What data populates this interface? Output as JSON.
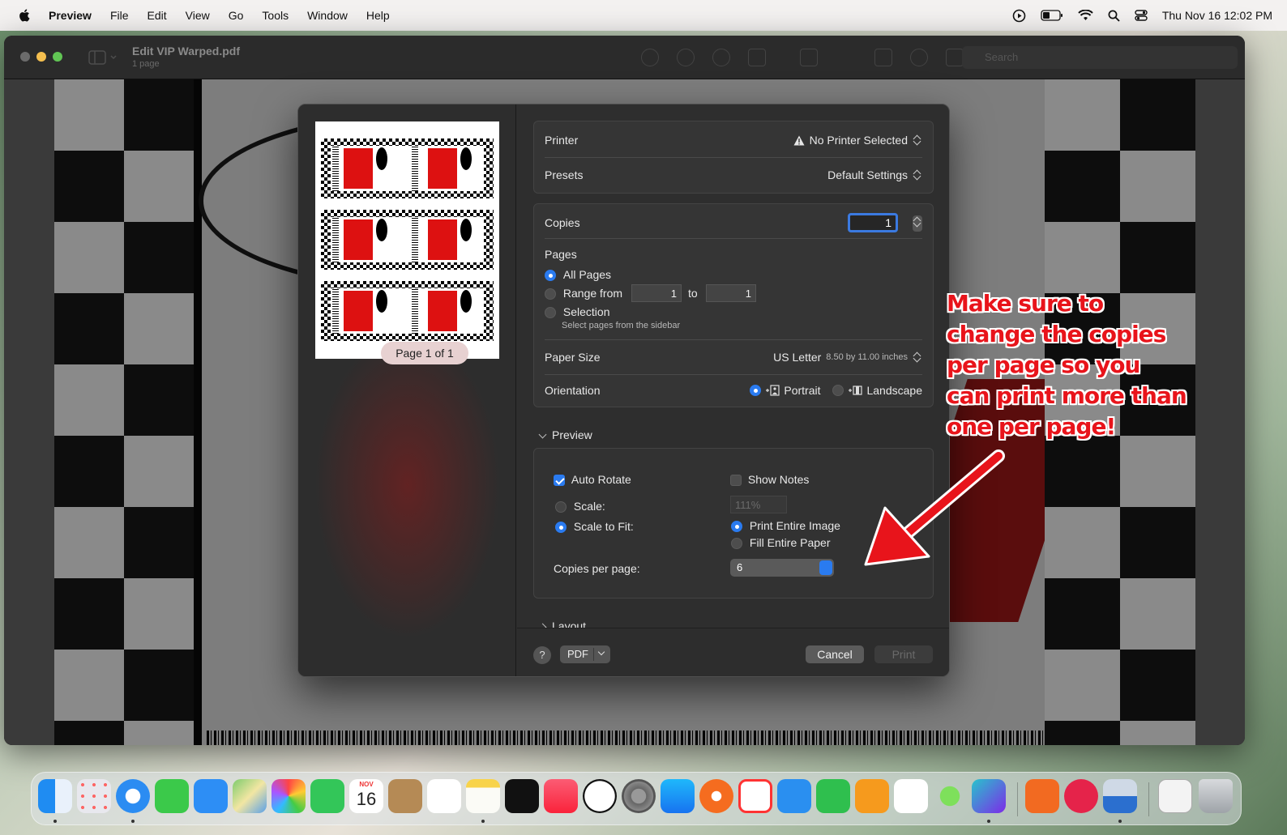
{
  "menubar": {
    "app_name": "Preview",
    "items": [
      "File",
      "Edit",
      "View",
      "Go",
      "Tools",
      "Window",
      "Help"
    ],
    "clock": "Thu Nov 16  12:02 PM"
  },
  "window": {
    "title": "Edit VIP Warped.pdf",
    "subtitle": "1 page",
    "search_placeholder": "Search"
  },
  "dialog": {
    "thumbnail": {
      "page_label": "Page 1 of 1"
    },
    "printer": {
      "label": "Printer",
      "value": "No Printer Selected"
    },
    "presets": {
      "label": "Presets",
      "value": "Default Settings"
    },
    "copies": {
      "label": "Copies",
      "value": "1"
    },
    "pages": {
      "label": "Pages",
      "all_pages": "All Pages",
      "range_from": "Range from",
      "range_start": "1",
      "to": "to",
      "range_end": "1",
      "selection": "Selection",
      "selection_hint": "Select pages from the sidebar",
      "selected": "all_pages"
    },
    "paper_size": {
      "label": "Paper Size",
      "value": "US Letter",
      "detail": "8.50 by 11.00 inches"
    },
    "orientation": {
      "label": "Orientation",
      "portrait": "Portrait",
      "landscape": "Landscape",
      "selected": "portrait"
    },
    "preview_section": {
      "title": "Preview",
      "auto_rotate": "Auto Rotate",
      "auto_rotate_checked": true,
      "show_notes": "Show Notes",
      "show_notes_checked": false,
      "scale": "Scale:",
      "scale_value": "111%",
      "scale_to_fit": "Scale to Fit:",
      "print_entire_image": "Print Entire Image",
      "fill_entire_paper": "Fill Entire Paper",
      "copies_per_page_label": "Copies per page:",
      "copies_per_page_value": "6"
    },
    "layout_section": {
      "title": "Layout"
    },
    "footer": {
      "help": "?",
      "pdf": "PDF",
      "cancel": "Cancel",
      "print": "Print"
    }
  },
  "annotation": {
    "lines": [
      "Make sure to",
      "change the copies",
      "per page so you",
      "can print more than",
      "one per page!"
    ],
    "color": "#e8141b"
  },
  "dock": {
    "calendar_month": "NOV",
    "calendar_day": "16",
    "apps": [
      "finder-icon",
      "launchpad-icon",
      "safari-icon",
      "messages-icon",
      "mail-icon",
      "maps-icon",
      "photos-icon",
      "facetime-icon",
      "calendar-icon",
      "contacts-icon",
      "reminders-icon",
      "notes-icon",
      "apple-tv-icon",
      "music-icon",
      "clock-icon",
      "system-settings-icon",
      "app-store-icon",
      "origin-icon",
      "news-icon",
      "keynote-icon",
      "numbers-icon",
      "pages-icon",
      "freeform-icon",
      "sims-icon",
      "canva-icon",
      "honey-icon",
      "lips-app-icon",
      "preview-icon",
      "documents-folder-icon",
      "trash-icon"
    ]
  },
  "colors": {
    "accent_blue": "#2a7bf0",
    "dialog_bg": "#2e2e2e",
    "annotation_red": "#e8141b"
  }
}
